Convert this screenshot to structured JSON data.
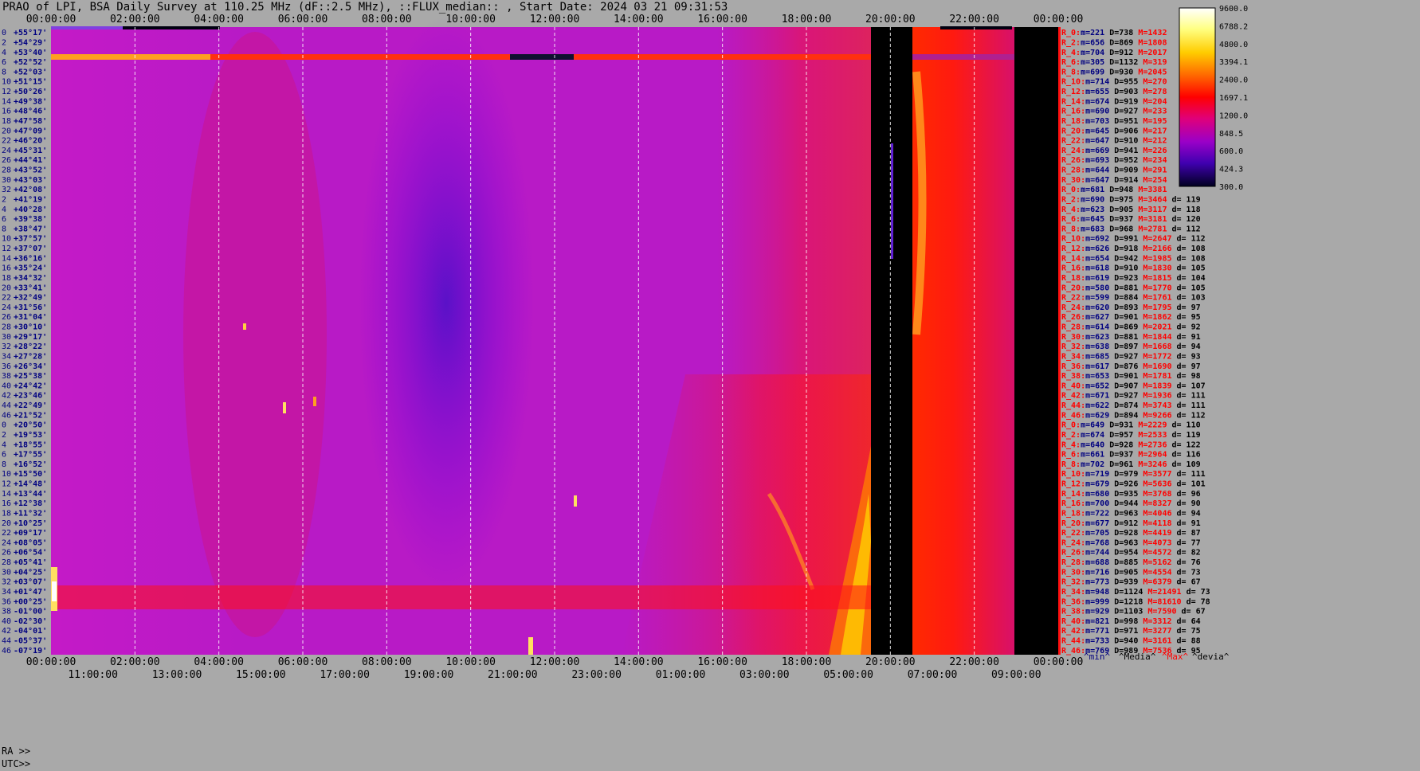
{
  "title": "PRAO of LPI, BSA Daily Survey at 110.25 MHz (dF::2.5 MHz), ::FLUX_median:: , Start Date: 2024 03 21 09:31:53",
  "footer": {
    "ra_prefix": "RA >>",
    "utc_prefix": "UTC>>"
  },
  "legend_footer": [
    "^min^",
    "^Media^",
    "^Max^",
    "^devia^"
  ],
  "colors": {
    "background": "#a9a9a9",
    "min": "#000080",
    "media": "#000000",
    "max": "#ff0000",
    "devia": "#000000"
  },
  "chart_data": {
    "type": "heatmap",
    "title": "PRAO of LPI, BSA Daily Survey at 110.25 MHz (dF::2.5 MHz), ::FLUX_median:: , Start Date: 2024 03 21 09:31:53",
    "x_top_ticks": [
      "00:00:00",
      "02:00:00",
      "04:00:00",
      "06:00:00",
      "08:00:00",
      "10:00:00",
      "12:00:00",
      "14:00:00",
      "16:00:00",
      "18:00:00",
      "20:00:00",
      "22:00:00",
      "00:00:00"
    ],
    "x_bottom_ra_ticks": [
      "00:00:00",
      "02:00:00",
      "04:00:00",
      "06:00:00",
      "08:00:00",
      "10:00:00",
      "12:00:00",
      "14:00:00",
      "16:00:00",
      "18:00:00",
      "20:00:00",
      "22:00:00",
      "00:00:00"
    ],
    "x_bottom_utc_ticks": [
      "11:00:00",
      "13:00:00",
      "15:00:00",
      "17:00:00",
      "19:00:00",
      "21:00:00",
      "23:00:00",
      "01:00:00",
      "03:00:00",
      "05:00:00",
      "07:00:00",
      "09:00:00"
    ],
    "colorbar_ticks": [
      "9600.0",
      "6788.2",
      "4800.0",
      "3394.1",
      "2400.0",
      "1697.1",
      "1200.0",
      "848.5",
      "600.0",
      "424.3",
      "300.0"
    ],
    "rows": [
      {
        "n": "0",
        "dec": "+55°17'",
        "r": "R_0:",
        "min": "221",
        "med": "738",
        "max": "1432",
        "d": ""
      },
      {
        "n": "2",
        "dec": "+54°29'",
        "r": "R_2:",
        "min": "656",
        "med": "869",
        "max": "1808",
        "d": ""
      },
      {
        "n": "4",
        "dec": "+53°40'",
        "r": "R_4:",
        "min": "704",
        "med": "912",
        "max": "2017",
        "d": ""
      },
      {
        "n": "6",
        "dec": "+52°52'",
        "r": "R_6:",
        "min": "305",
        "med": "1132",
        "max": "319",
        "d": ""
      },
      {
        "n": "8",
        "dec": "+52°03'",
        "r": "R_8:",
        "min": "699",
        "med": "930",
        "max": "2045",
        "d": ""
      },
      {
        "n": "10",
        "dec": "+51°15'",
        "r": "R_10:",
        "min": "714",
        "med": "955",
        "max": "270",
        "d": ""
      },
      {
        "n": "12",
        "dec": "+50°26'",
        "r": "R_12:",
        "min": "655",
        "med": "903",
        "max": "278",
        "d": ""
      },
      {
        "n": "14",
        "dec": "+49°38'",
        "r": "R_14:",
        "min": "674",
        "med": "919",
        "max": "204",
        "d": ""
      },
      {
        "n": "16",
        "dec": "+48°46'",
        "r": "R_16:",
        "min": "690",
        "med": "927",
        "max": "233",
        "d": ""
      },
      {
        "n": "18",
        "dec": "+47°58'",
        "r": "R_18:",
        "min": "703",
        "med": "951",
        "max": "195",
        "d": ""
      },
      {
        "n": "20",
        "dec": "+47°09'",
        "r": "R_20:",
        "min": "645",
        "med": "906",
        "max": "217",
        "d": ""
      },
      {
        "n": "22",
        "dec": "+46°20'",
        "r": "R_22:",
        "min": "647",
        "med": "910",
        "max": "212",
        "d": ""
      },
      {
        "n": "24",
        "dec": "+45°31'",
        "r": "R_24:",
        "min": "669",
        "med": "941",
        "max": "226",
        "d": ""
      },
      {
        "n": "26",
        "dec": "+44°41'",
        "r": "R_26:",
        "min": "693",
        "med": "952",
        "max": "234",
        "d": ""
      },
      {
        "n": "28",
        "dec": "+43°52'",
        "r": "R_28:",
        "min": "644",
        "med": "909",
        "max": "291",
        "d": ""
      },
      {
        "n": "30",
        "dec": "+43°03'",
        "r": "R_30:",
        "min": "647",
        "med": "914",
        "max": "254",
        "d": ""
      },
      {
        "n": "32",
        "dec": "+42°08'",
        "r": "R_0:",
        "min": "681",
        "med": "948",
        "max": "3381",
        "d": ""
      },
      {
        "n": "2",
        "dec": "+41°19'",
        "r": "R_2:",
        "min": "690",
        "med": "975",
        "max": "3464",
        "d": "119"
      },
      {
        "n": "4",
        "dec": "+40°28'",
        "r": "R_4:",
        "min": "623",
        "med": "905",
        "max": "3117",
        "d": "118"
      },
      {
        "n": "6",
        "dec": "+39°38'",
        "r": "R_6:",
        "min": "645",
        "med": "937",
        "max": "3181",
        "d": "120"
      },
      {
        "n": "8",
        "dec": "+38°47'",
        "r": "R_8:",
        "min": "683",
        "med": "968",
        "max": "2781",
        "d": "112"
      },
      {
        "n": "10",
        "dec": "+37°57'",
        "r": "R_10:",
        "min": "692",
        "med": "991",
        "max": "2647",
        "d": "112"
      },
      {
        "n": "12",
        "dec": "+37°07'",
        "r": "R_12:",
        "min": "626",
        "med": "918",
        "max": "2166",
        "d": "108"
      },
      {
        "n": "14",
        "dec": "+36°16'",
        "r": "R_14:",
        "min": "654",
        "med": "942",
        "max": "1985",
        "d": "108"
      },
      {
        "n": "16",
        "dec": "+35°24'",
        "r": "R_16:",
        "min": "618",
        "med": "910",
        "max": "1830",
        "d": "105"
      },
      {
        "n": "18",
        "dec": "+34°32'",
        "r": "R_18:",
        "min": "619",
        "med": "923",
        "max": "1815",
        "d": "104"
      },
      {
        "n": "20",
        "dec": "+33°41'",
        "r": "R_20:",
        "min": "580",
        "med": "881",
        "max": "1770",
        "d": "105"
      },
      {
        "n": "22",
        "dec": "+32°49'",
        "r": "R_22:",
        "min": "599",
        "med": "884",
        "max": "1761",
        "d": "103"
      },
      {
        "n": "24",
        "dec": "+31°56'",
        "r": "R_24:",
        "min": "620",
        "med": "893",
        "max": "1795",
        "d": "97"
      },
      {
        "n": "26",
        "dec": "+31°04'",
        "r": "R_26:",
        "min": "627",
        "med": "901",
        "max": "1862",
        "d": "95"
      },
      {
        "n": "28",
        "dec": "+30°10'",
        "r": "R_28:",
        "min": "614",
        "med": "869",
        "max": "2021",
        "d": "92"
      },
      {
        "n": "30",
        "dec": "+29°17'",
        "r": "R_30:",
        "min": "623",
        "med": "881",
        "max": "1844",
        "d": "91"
      },
      {
        "n": "32",
        "dec": "+28°22'",
        "r": "R_32:",
        "min": "638",
        "med": "897",
        "max": "1668",
        "d": "94"
      },
      {
        "n": "34",
        "dec": "+27°28'",
        "r": "R_34:",
        "min": "685",
        "med": "927",
        "max": "1772",
        "d": "93"
      },
      {
        "n": "36",
        "dec": "+26°34'",
        "r": "R_36:",
        "min": "617",
        "med": "876",
        "max": "1690",
        "d": "97"
      },
      {
        "n": "38",
        "dec": "+25°38'",
        "r": "R_38:",
        "min": "653",
        "med": "901",
        "max": "1781",
        "d": "98"
      },
      {
        "n": "40",
        "dec": "+24°42'",
        "r": "R_40:",
        "min": "652",
        "med": "907",
        "max": "1839",
        "d": "107"
      },
      {
        "n": "42",
        "dec": "+23°46'",
        "r": "R_42:",
        "min": "671",
        "med": "927",
        "max": "1936",
        "d": "111"
      },
      {
        "n": "44",
        "dec": "+22°49'",
        "r": "R_44:",
        "min": "622",
        "med": "874",
        "max": "3743",
        "d": "111"
      },
      {
        "n": "46",
        "dec": "+21°52'",
        "r": "R_46:",
        "min": "629",
        "med": "894",
        "max": "9266",
        "d": "112"
      },
      {
        "n": "0",
        "dec": "+20°50'",
        "r": "R_0:",
        "min": "649",
        "med": "931",
        "max": "2229",
        "d": "110"
      },
      {
        "n": "2",
        "dec": "+19°53'",
        "r": "R_2:",
        "min": "674",
        "med": "957",
        "max": "2533",
        "d": "119"
      },
      {
        "n": "4",
        "dec": "+18°55'",
        "r": "R_4:",
        "min": "640",
        "med": "928",
        "max": "2736",
        "d": "122"
      },
      {
        "n": "6",
        "dec": "+17°55'",
        "r": "R_6:",
        "min": "661",
        "med": "937",
        "max": "2964",
        "d": "116"
      },
      {
        "n": "8",
        "dec": "+16°52'",
        "r": "R_8:",
        "min": "702",
        "med": "961",
        "max": "3246",
        "d": "109"
      },
      {
        "n": "10",
        "dec": "+15°50'",
        "r": "R_10:",
        "min": "719",
        "med": "979",
        "max": "3577",
        "d": "111"
      },
      {
        "n": "12",
        "dec": "+14°48'",
        "r": "R_12:",
        "min": "679",
        "med": "926",
        "max": "5636",
        "d": "101"
      },
      {
        "n": "14",
        "dec": "+13°44'",
        "r": "R_14:",
        "min": "680",
        "med": "935",
        "max": "3768",
        "d": "96"
      },
      {
        "n": "16",
        "dec": "+12°38'",
        "r": "R_16:",
        "min": "700",
        "med": "944",
        "max": "8327",
        "d": "90"
      },
      {
        "n": "18",
        "dec": "+11°32'",
        "r": "R_18:",
        "min": "722",
        "med": "963",
        "max": "4046",
        "d": "94"
      },
      {
        "n": "20",
        "dec": "+10°25'",
        "r": "R_20:",
        "min": "677",
        "med": "912",
        "max": "4118",
        "d": "91"
      },
      {
        "n": "22",
        "dec": "+09°17'",
        "r": "R_22:",
        "min": "705",
        "med": "928",
        "max": "4419",
        "d": "87"
      },
      {
        "n": "24",
        "dec": "+08°05'",
        "r": "R_24:",
        "min": "768",
        "med": "963",
        "max": "4073",
        "d": "77"
      },
      {
        "n": "26",
        "dec": "+06°54'",
        "r": "R_26:",
        "min": "744",
        "med": "954",
        "max": "4572",
        "d": "82"
      },
      {
        "n": "28",
        "dec": "+05°41'",
        "r": "R_28:",
        "min": "688",
        "med": "885",
        "max": "5162",
        "d": "76"
      },
      {
        "n": "30",
        "dec": "+04°25'",
        "r": "R_30:",
        "min": "716",
        "med": "905",
        "max": "4554",
        "d": "73"
      },
      {
        "n": "32",
        "dec": "+03°07'",
        "r": "R_32:",
        "min": "773",
        "med": "939",
        "max": "6379",
        "d": "67"
      },
      {
        "n": "34",
        "dec": "+01°47'",
        "r": "R_34:",
        "min": "948",
        "med": "1124",
        "max": "21491",
        "d": "73"
      },
      {
        "n": "36",
        "dec": "+00°25'",
        "r": "R_36:",
        "min": "999",
        "med": "1218",
        "max": "81610",
        "d": "78"
      },
      {
        "n": "38",
        "dec": "-01°00'",
        "r": "R_38:",
        "min": "929",
        "med": "1103",
        "max": "7590",
        "d": "67"
      },
      {
        "n": "40",
        "dec": "-02°30'",
        "r": "R_40:",
        "min": "821",
        "med": "998",
        "max": "3312",
        "d": "64"
      },
      {
        "n": "42",
        "dec": "-04°01'",
        "r": "R_42:",
        "min": "771",
        "med": "971",
        "max": "3277",
        "d": "75"
      },
      {
        "n": "44",
        "dec": "-05°37'",
        "r": "R_44:",
        "min": "733",
        "med": "940",
        "max": "3161",
        "d": "88"
      },
      {
        "n": "46",
        "dec": "-07°19'",
        "r": "R_46:",
        "min": "769",
        "med": "989",
        "max": "7536",
        "d": "95"
      }
    ]
  }
}
